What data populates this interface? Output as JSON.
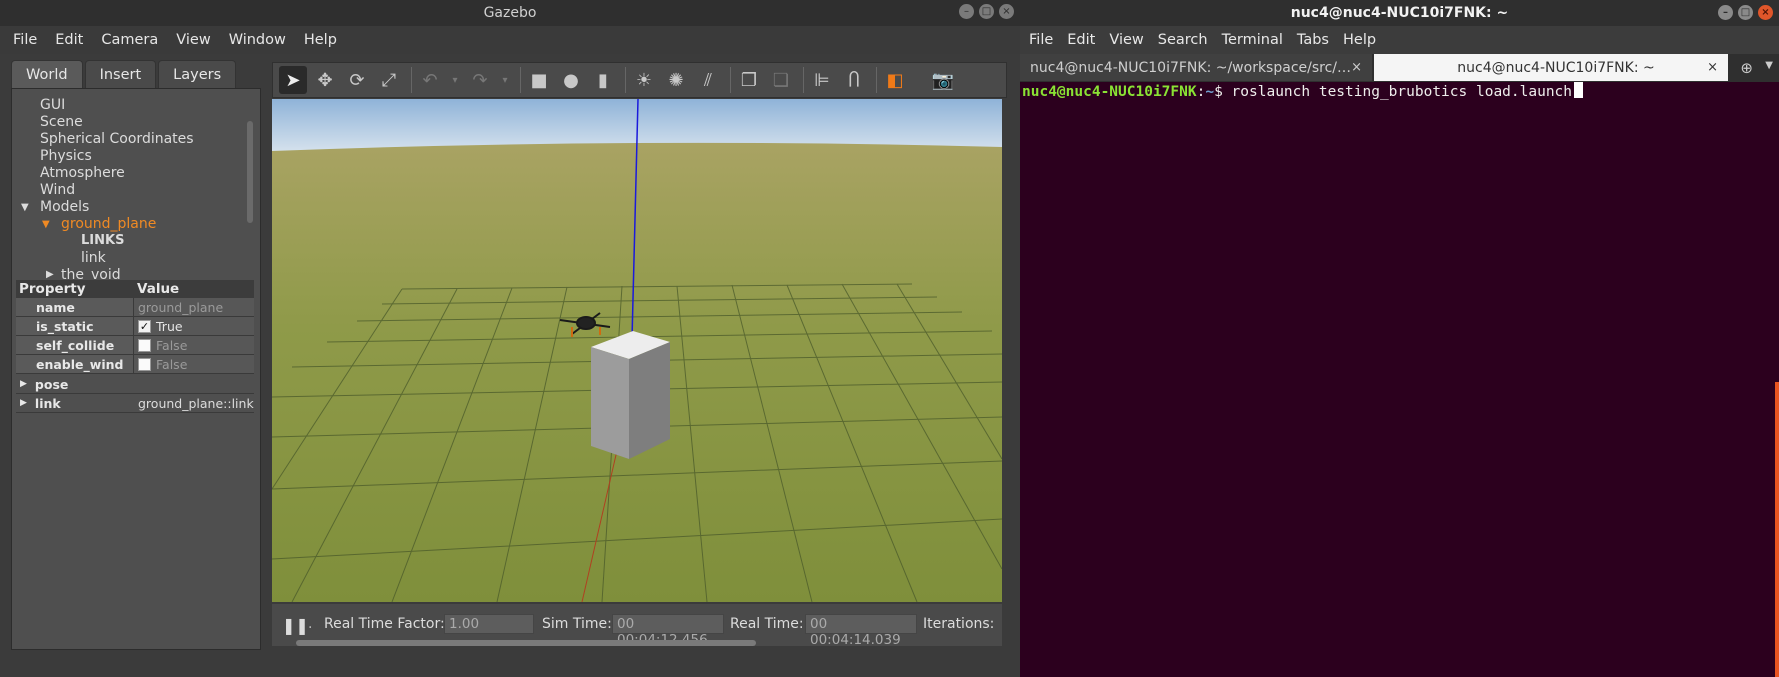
{
  "gazebo": {
    "title": "Gazebo",
    "window_buttons": [
      "–",
      "□",
      "×"
    ],
    "menu": [
      "File",
      "Edit",
      "Camera",
      "View",
      "Window",
      "Help"
    ],
    "tabs": [
      "World",
      "Insert",
      "Layers"
    ],
    "tree": {
      "items": [
        "GUI",
        "Scene",
        "Spherical Coordinates",
        "Physics",
        "Atmosphere",
        "Wind",
        "Models",
        "ground_plane",
        "LINKS",
        "link",
        "the_void"
      ]
    },
    "properties": {
      "header": {
        "key": "Property",
        "value": "Value"
      },
      "rows": [
        {
          "key": "name",
          "value": "ground_plane"
        },
        {
          "key": "is_static",
          "value": "True",
          "checked": true
        },
        {
          "key": "self_collide",
          "value": "False",
          "checked": false
        },
        {
          "key": "enable_wind",
          "value": "False",
          "checked": false
        },
        {
          "key": "pose",
          "value": ""
        },
        {
          "key": "link",
          "value": "ground_plane::link"
        }
      ]
    },
    "toolbar_icons": [
      "select-arrow-icon",
      "translate-icon",
      "rotate-icon",
      "scale-icon",
      "undo-icon",
      "undo-dropdown-icon",
      "redo-icon",
      "redo-dropdown-icon",
      "box-icon",
      "sphere-icon",
      "cylinder-icon",
      "point-light-icon",
      "spot-light-icon",
      "directional-light-icon",
      "copy-icon",
      "paste-icon",
      "align-icon",
      "snap-icon",
      "view-angle-icon",
      "screenshot-icon"
    ],
    "status": {
      "rtf_label": "Real Time Factor:",
      "rtf_value": "1.00",
      "sim_time_label": "Sim Time:",
      "sim_time_value": "00 00:04:12.456",
      "real_time_label": "Real Time:",
      "real_time_value": "00 00:04:14.039",
      "iterations_label": "Iterations:"
    }
  },
  "terminal": {
    "title": "nuc4@nuc4-NUC10i7FNK: ~",
    "menu": [
      "File",
      "Edit",
      "View",
      "Search",
      "Terminal",
      "Tabs",
      "Help"
    ],
    "tabs": [
      {
        "label": "nuc4@nuc4-NUC10i7FNK: ~/workspace/src/…",
        "active": false
      },
      {
        "label": "nuc4@nuc4-NUC10i7FNK: ~",
        "active": true
      }
    ],
    "prompt_user": "nuc4@nuc4-NUC10i7FNK",
    "prompt_colon": ":",
    "prompt_path": "~",
    "prompt_dollar": "$ ",
    "command": "roslaunch testing_brubotics load.launch",
    "colors": {
      "background": "#2c001e",
      "user": "#8ae234",
      "path": "#729fcf",
      "accent": "#e95420"
    }
  }
}
